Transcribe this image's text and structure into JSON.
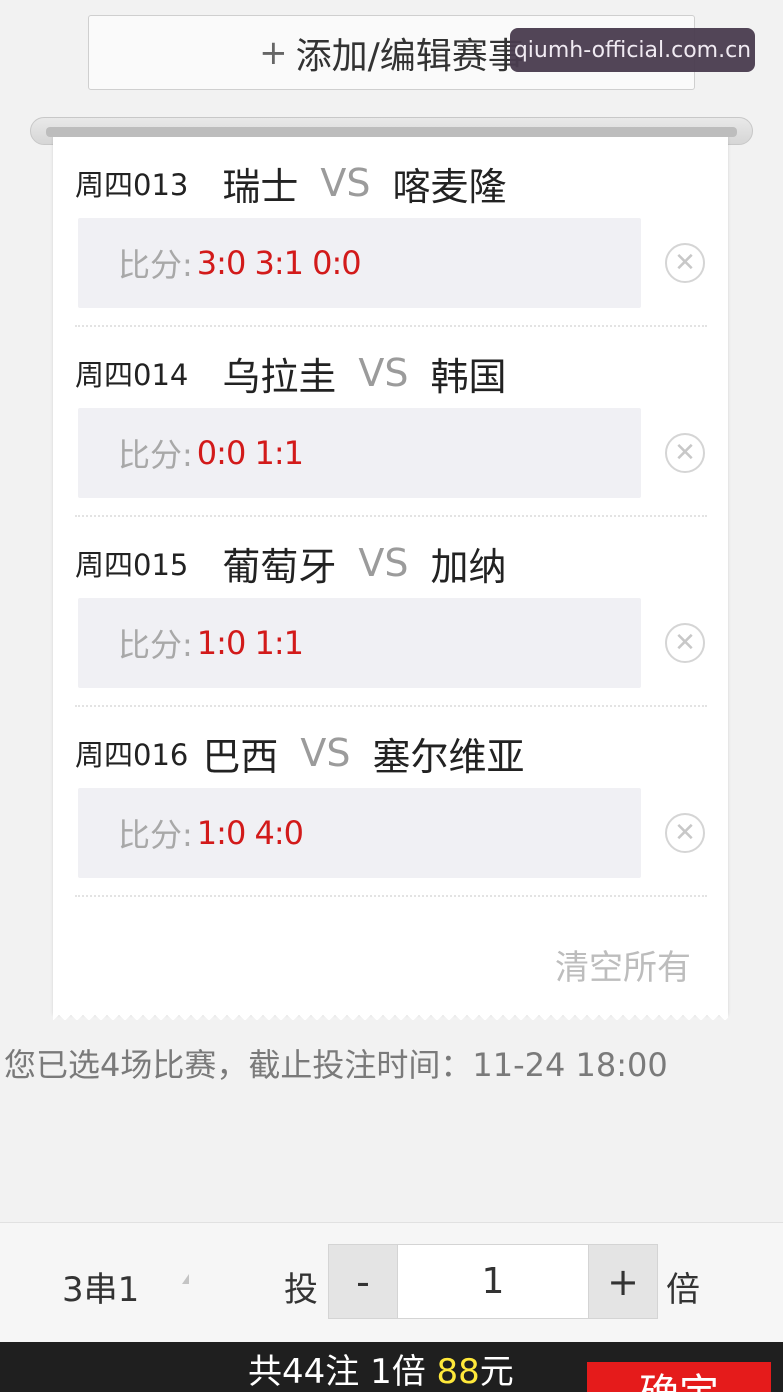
{
  "top": {
    "add_edit_icon": "+",
    "add_edit_label": "添加/编辑赛事",
    "watermark": "qiumh-official.com.cn"
  },
  "matches": [
    {
      "code": "周四013",
      "home": "瑞士",
      "vs": "VS",
      "away": "喀麦隆",
      "score_label": "比分:",
      "scores": "3:0 3:1 0:0"
    },
    {
      "code": "周四014",
      "home": "乌拉圭",
      "vs": "VS",
      "away": "韩国",
      "score_label": "比分:",
      "scores": "0:0 1:1"
    },
    {
      "code": "周四015",
      "home": "葡萄牙",
      "vs": "VS",
      "away": "加纳",
      "score_label": "比分:",
      "scores": "1:0 1:1"
    },
    {
      "code": "周四016",
      "home": "巴西",
      "vs": "VS",
      "away": "塞尔维亚",
      "score_label": "比分:",
      "scores": "1:0 4:0"
    }
  ],
  "clear_all_label": "清空所有",
  "selected_info": "您已选4场比赛，截止投注时间：11-24 18:00",
  "controls": {
    "parlay_type": "3串1",
    "tou_label": "投",
    "minus_label": "-",
    "multiplier": "1",
    "plus_label": "+",
    "bei_label": "倍"
  },
  "summary": {
    "prefix": "共44注 1倍 ",
    "amount": "88",
    "suffix": "元"
  },
  "confirm_label": "确定",
  "colors": {
    "score_red": "#d21a1a",
    "amount_yellow": "#ffe83a",
    "confirm_red": "#e51b1b"
  }
}
